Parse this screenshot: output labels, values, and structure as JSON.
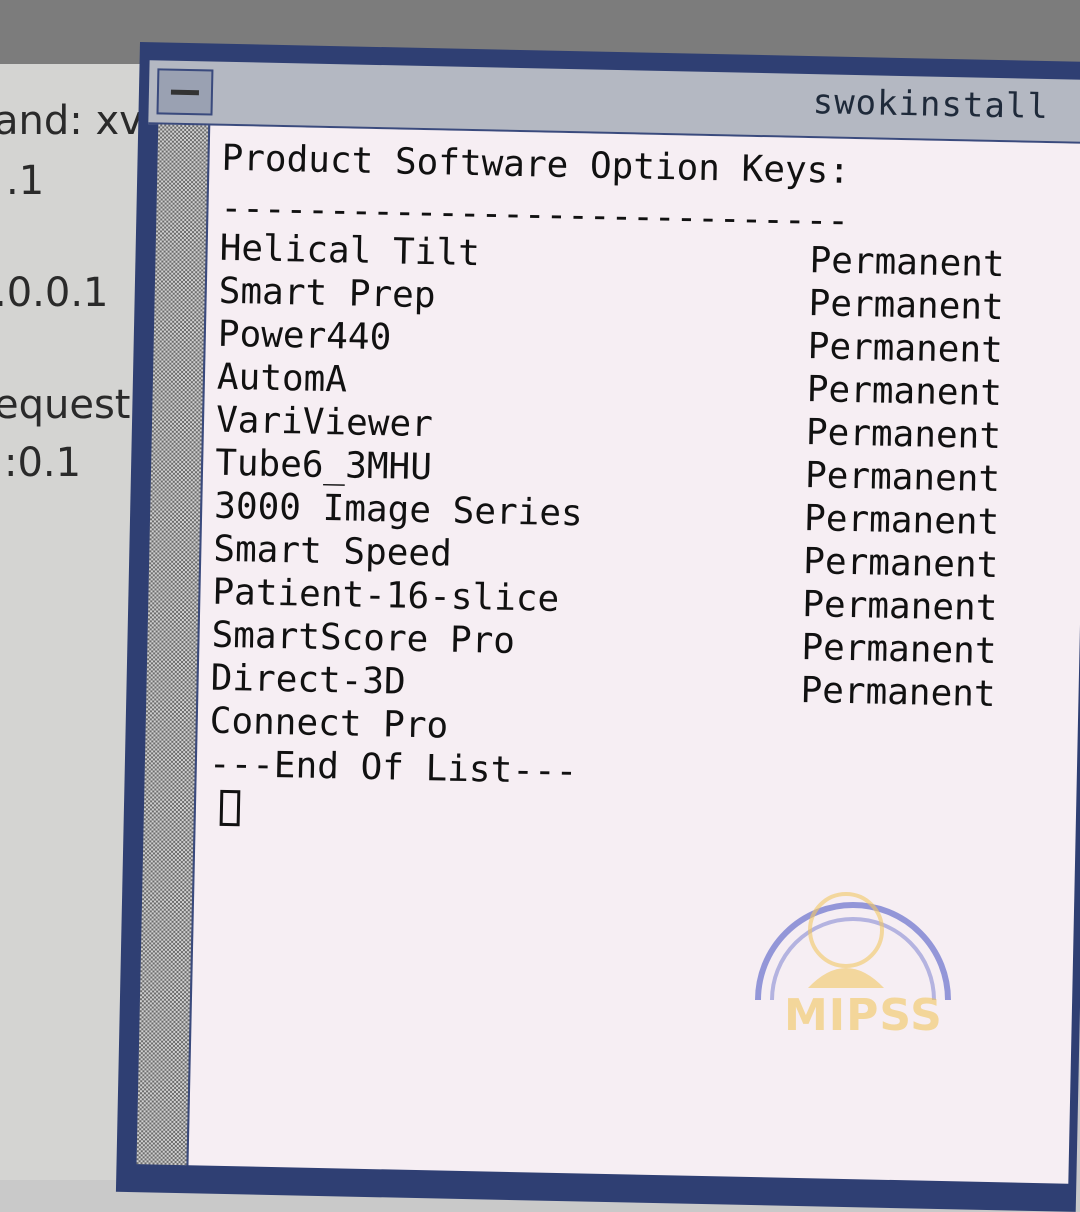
{
  "background_window": {
    "lines": [
      "and: xv",
      ".1",
      ".0.0.1",
      "equeste",
      ":0.1"
    ]
  },
  "terminal": {
    "title": "swokinstall",
    "heading": "Product Software Option Keys:",
    "rule": "-----------------------------",
    "options": [
      {
        "name": "Helical Tilt",
        "status": "Permanent"
      },
      {
        "name": "Smart Prep",
        "status": "Permanent"
      },
      {
        "name": "Power440",
        "status": "Permanent"
      },
      {
        "name": "AutomA",
        "status": "Permanent"
      },
      {
        "name": "VariViewer",
        "status": "Permanent"
      },
      {
        "name": "Tube6_3MHU",
        "status": "Permanent"
      },
      {
        "name": "3000 Image Series",
        "status": "Permanent"
      },
      {
        "name": "Smart Speed",
        "status": "Permanent"
      },
      {
        "name": "Patient-16-slice",
        "status": "Permanent"
      },
      {
        "name": "SmartScore Pro",
        "status": "Permanent"
      },
      {
        "name": "Direct-3D",
        "status": "Permanent"
      },
      {
        "name": "Connect Pro",
        "status": ""
      }
    ],
    "end_of_list": "---End Of List---"
  },
  "watermark": {
    "text": "MIPSS",
    "colors": {
      "arc": "#5b64c8",
      "sun": "#f0c04a"
    }
  },
  "colors": {
    "window_frame": "#2f3f73",
    "terminal_bg": "#f6eef3",
    "text": "#111111"
  }
}
